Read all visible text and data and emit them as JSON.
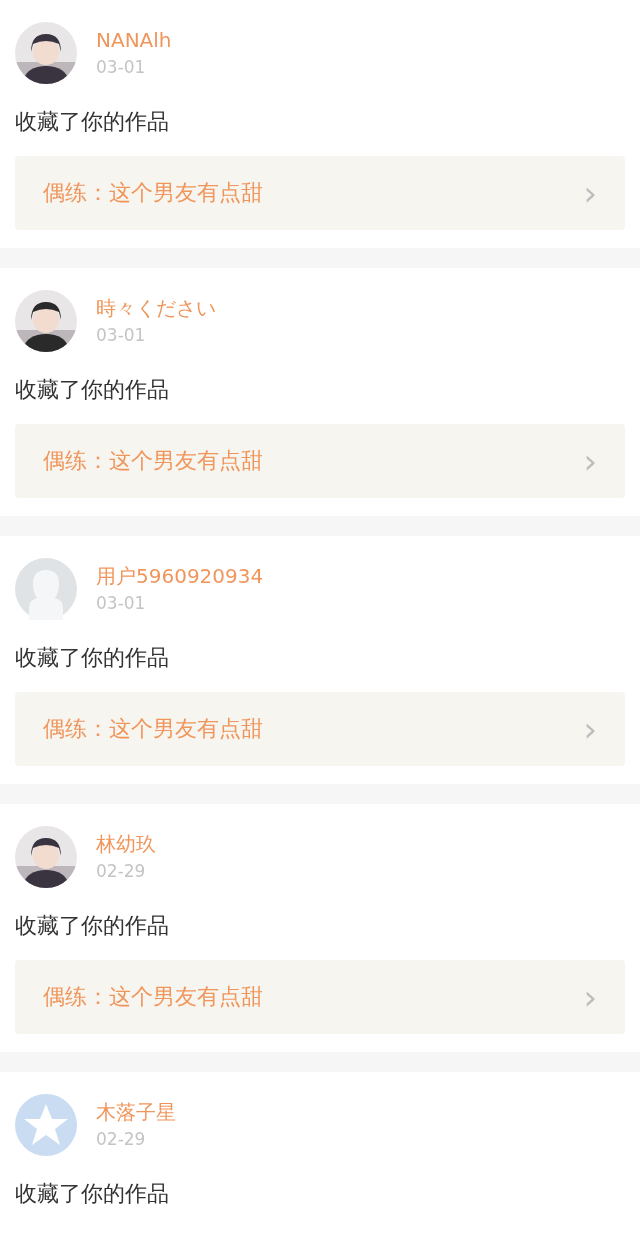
{
  "notifications": [
    {
      "name": "NANAlh",
      "date": "03-01",
      "action": "收藏了你的作品",
      "work": {
        "title": "偶练：这个男友有点甜",
        "arrow": "›"
      }
    },
    {
      "name": "時々ください",
      "date": "03-01",
      "action": "收藏了你的作品",
      "work": {
        "title": "偶练：这个男友有点甜",
        "arrow": "›"
      }
    },
    {
      "avatar": {
        "kind": "default"
      },
      "name": "用户5960920934",
      "date": "03-01",
      "action": "收藏了你的作品",
      "work": {
        "title": "偶练：这个男友有点甜",
        "arrow": "›"
      }
    },
    {
      "name": "林幼玖",
      "date": "02-29",
      "action": "收藏了你的作品",
      "work": {
        "title": "偶练：这个男友有点甜",
        "arrow": "›"
      }
    },
    {
      "avatar": {
        "kind": "star"
      },
      "name": "木落子星",
      "date": "02-29",
      "action": "收藏了你的作品"
    }
  ]
}
